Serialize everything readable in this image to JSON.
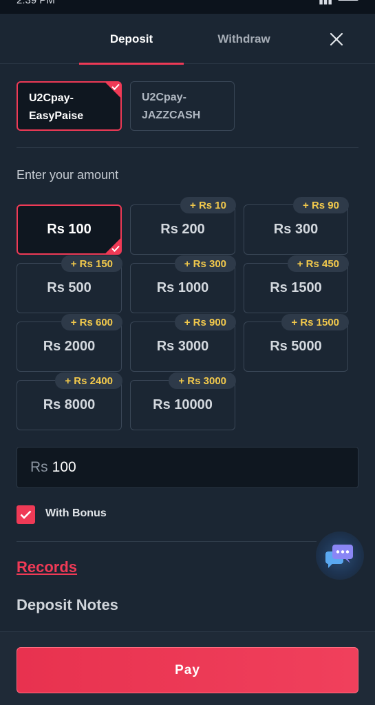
{
  "status_bar": {
    "time": "2:39 PM"
  },
  "tabs": [
    {
      "label": "Deposit",
      "active": true
    },
    {
      "label": "Withdraw",
      "active": false
    }
  ],
  "payment_methods": [
    {
      "line1": "U2Cpay-",
      "line2": "EasyPaise",
      "selected": true
    },
    {
      "line1": "U2Cpay-",
      "line2": "JAZZCASH",
      "selected": false
    }
  ],
  "amount_section_label": "Enter your amount",
  "amounts": [
    {
      "label": "Rs 100",
      "bonus": "",
      "selected": true
    },
    {
      "label": "Rs 200",
      "bonus": "+ Rs 10"
    },
    {
      "label": "Rs 300",
      "bonus": "+ Rs 90"
    },
    {
      "label": "Rs 500",
      "bonus": "+ Rs 150"
    },
    {
      "label": "Rs 1000",
      "bonus": "+ Rs 300"
    },
    {
      "label": "Rs 1500",
      "bonus": "+ Rs 450"
    },
    {
      "label": "Rs 2000",
      "bonus": "+ Rs 600"
    },
    {
      "label": "Rs 3000",
      "bonus": "+ Rs 900"
    },
    {
      "label": "Rs 5000",
      "bonus": "+ Rs 1500"
    },
    {
      "label": "Rs 8000",
      "bonus": "+ Rs 2400"
    },
    {
      "label": "Rs 10000",
      "bonus": "+ Rs 3000"
    }
  ],
  "amount_input": {
    "currency": "Rs",
    "value": "100"
  },
  "with_bonus": {
    "label": "With Bonus",
    "checked": true
  },
  "records_label": "Records",
  "deposit_notes_title": "Deposit Notes",
  "pay_button": {
    "label": "Pay"
  },
  "colors": {
    "accent": "#ef3a56",
    "bonus_text": "#f2c94c",
    "background": "#1b2633"
  },
  "icons": {
    "close": "close-icon",
    "chat": "chat-bubbles-icon",
    "check": "check-icon"
  }
}
